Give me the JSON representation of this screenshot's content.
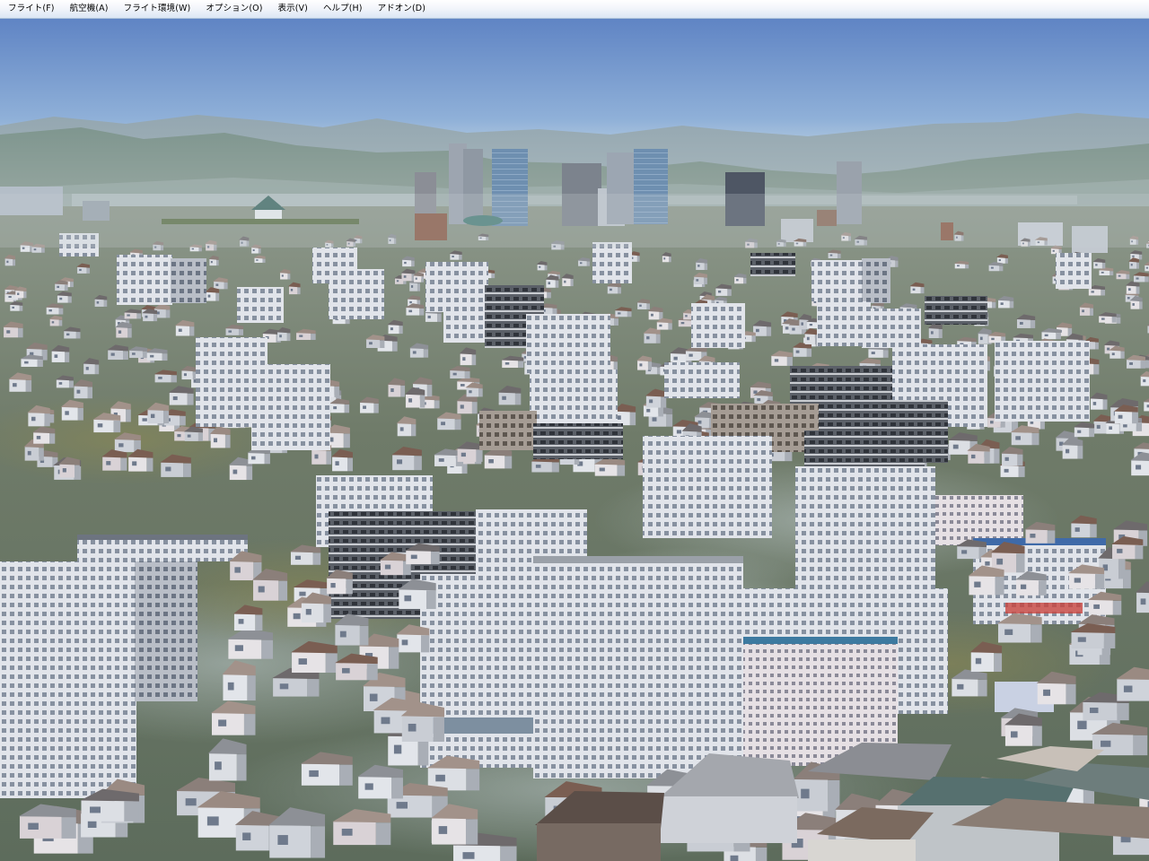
{
  "menu": {
    "items": [
      {
        "label": "フライト(F)"
      },
      {
        "label": "航空機(A)"
      },
      {
        "label": "フライト環境(W)"
      },
      {
        "label": "オプション(O)"
      },
      {
        "label": "表示(V)"
      },
      {
        "label": "ヘルプ(H)"
      },
      {
        "label": "アドオン(D)"
      }
    ]
  },
  "scene": {
    "colors": {
      "sky_top": "#5f84c4",
      "sky_horizon": "#a9c2dc",
      "mountains_far": "#8fa3ad",
      "mountains_near": "#7d9489",
      "ground": "#6d7c68",
      "building_white": "#d9dce3",
      "building_dark": "#4b5058",
      "roof_brown": "#7a5e52"
    }
  }
}
